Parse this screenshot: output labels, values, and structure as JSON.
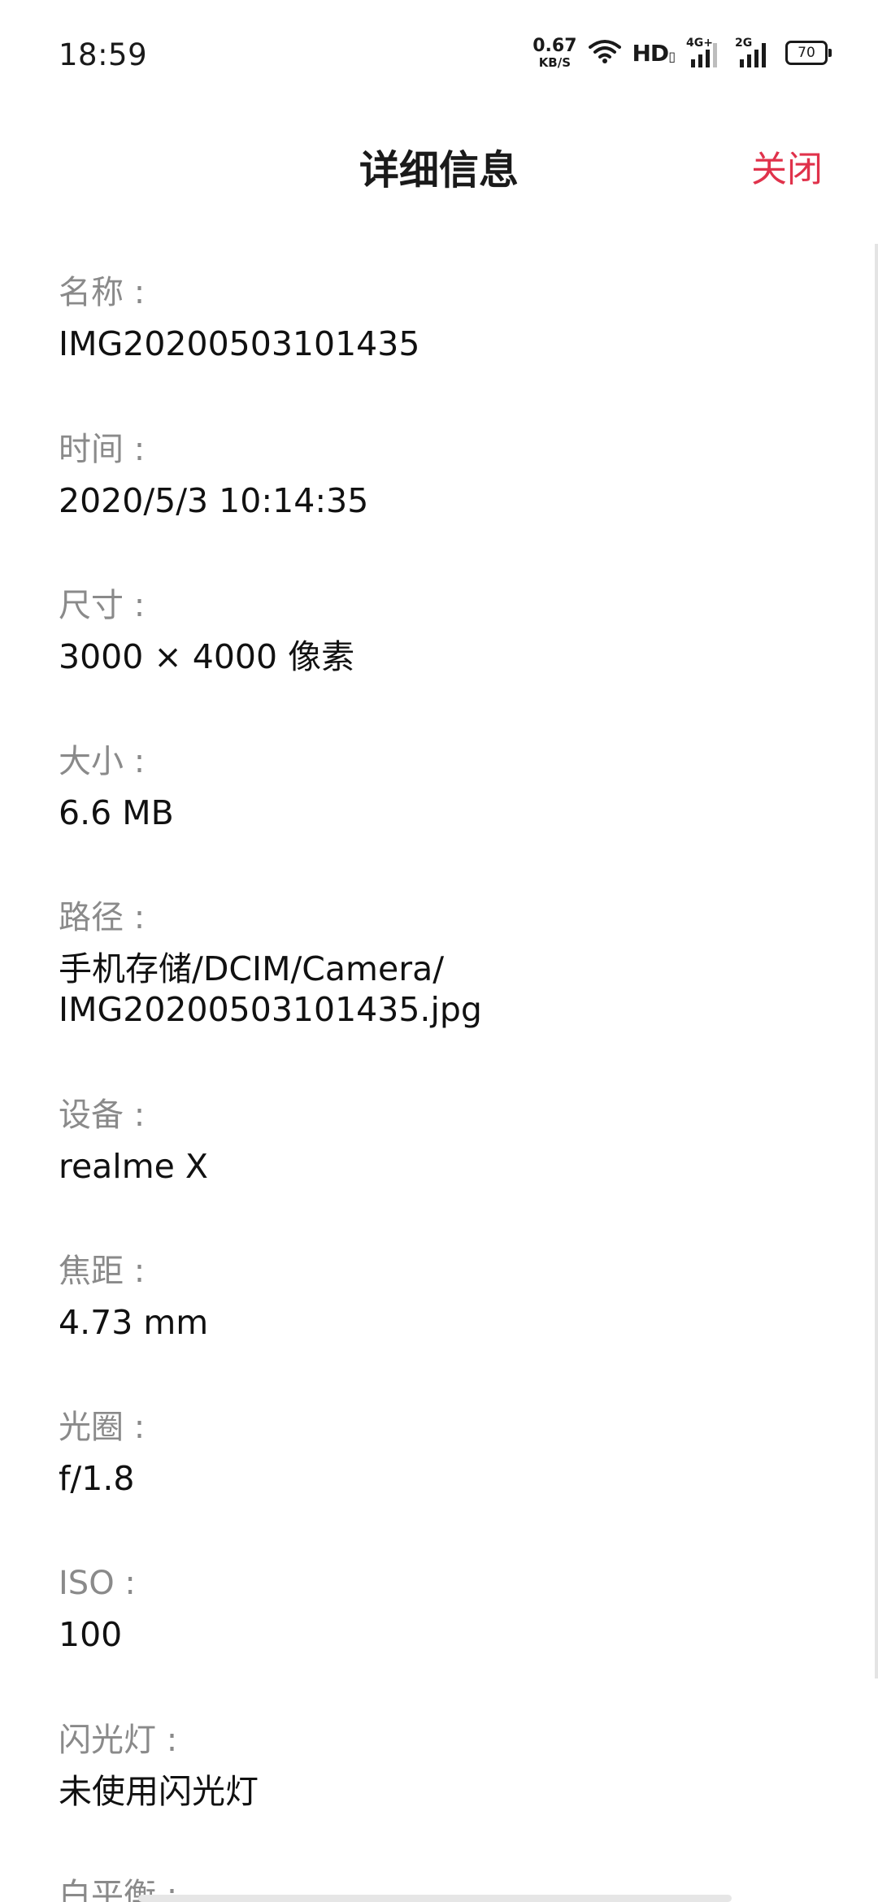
{
  "status_bar": {
    "time": "18:59",
    "net_speed_value": "0.67",
    "net_speed_unit": "KB/S",
    "hd_label": "HD",
    "network_4g": "4G+",
    "network_2g": "2G",
    "battery": "70"
  },
  "header": {
    "title": "详细信息",
    "close_label": "关闭",
    "accent_color": "#e0324b"
  },
  "details": [
    {
      "label": "名称 :",
      "value": "IMG20200503101435"
    },
    {
      "label": "时间 :",
      "value": "2020/5/3 10:14:35"
    },
    {
      "label": "尺寸 :",
      "value": "3000 × 4000 像素"
    },
    {
      "label": "大小 :",
      "value": "6.6 MB"
    },
    {
      "label": "路径 :",
      "value": "手机存储/DCIM/Camera/\nIMG20200503101435.jpg"
    },
    {
      "label": "设备 :",
      "value": "realme X"
    },
    {
      "label": "焦距 :",
      "value": "4.73 mm"
    },
    {
      "label": "光圈 :",
      "value": "f/1.8"
    },
    {
      "label": "ISO :",
      "value": "100"
    },
    {
      "label": "闪光灯 :",
      "value": "未使用闪光灯"
    },
    {
      "label": "白平衡 :",
      "value": ""
    }
  ]
}
